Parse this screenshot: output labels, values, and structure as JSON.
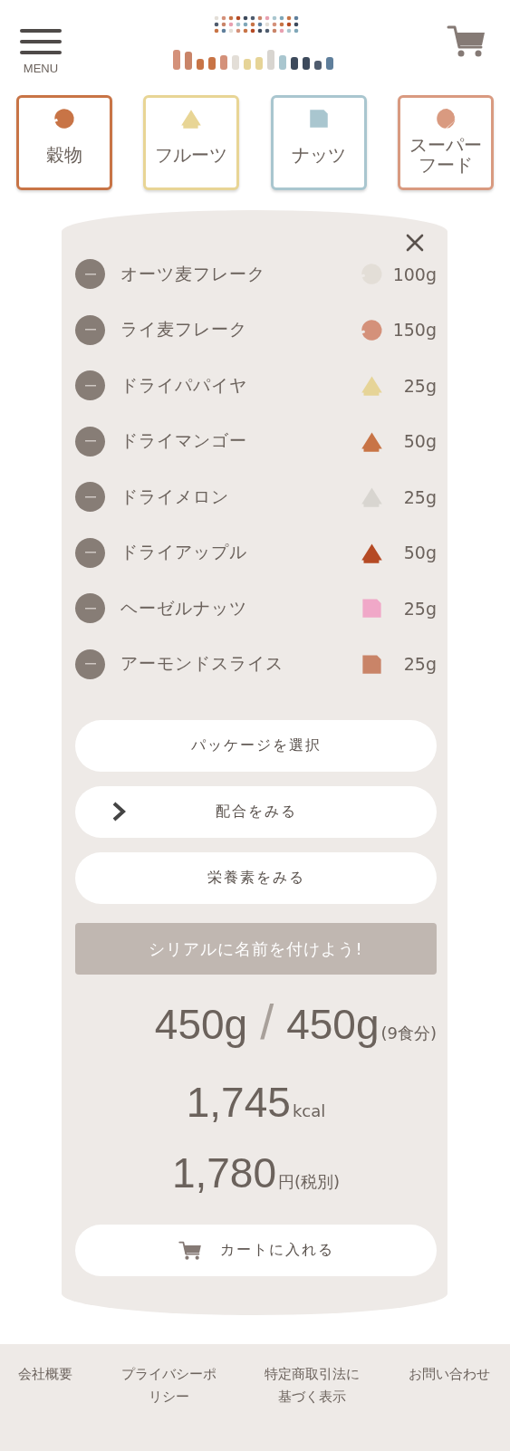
{
  "header": {
    "menu_label": "MENU"
  },
  "categories": [
    {
      "label": "穀物",
      "color": "#c87446",
      "kind": "round",
      "selected": false
    },
    {
      "label": "フルーツ",
      "color": "#e8d595",
      "kind": "triangle",
      "selected": false
    },
    {
      "label": "ナッツ",
      "color": "#a9c6cf",
      "kind": "square",
      "selected": false
    },
    {
      "label": "スーパーフード",
      "color": "#d99a80",
      "kind": "leaf",
      "selected": false
    }
  ],
  "ingredients": [
    {
      "name": "オーツ麦フレーク",
      "amount": "100g",
      "color": "#e3ded7",
      "kind": "round"
    },
    {
      "name": "ライ麦フレーク",
      "amount": "150g",
      "color": "#d4917a",
      "kind": "round"
    },
    {
      "name": "ドライパパイヤ",
      "amount": "25g",
      "color": "#e6d497",
      "kind": "triangle"
    },
    {
      "name": "ドライマンゴー",
      "amount": "50g",
      "color": "#c87446",
      "kind": "triangle"
    },
    {
      "name": "ドライメロン",
      "amount": "25g",
      "color": "#d8d5d0",
      "kind": "triangle"
    },
    {
      "name": "ドライアップル",
      "amount": "50g",
      "color": "#b54a24",
      "kind": "triangle"
    },
    {
      "name": "ヘーゼルナッツ",
      "amount": "25g",
      "color": "#f0a8c8",
      "kind": "square"
    },
    {
      "name": "アーモンドスライス",
      "amount": "25g",
      "color": "#c98468",
      "kind": "square"
    }
  ],
  "actions": [
    {
      "label": "パッケージを選択",
      "kind": "plain"
    },
    {
      "label": "配合をみる",
      "kind": "chevron"
    },
    {
      "label": "栄養素をみる",
      "kind": "plain"
    }
  ],
  "name_button": "シリアルに名前を付けよう!",
  "totals": {
    "weight": "450g",
    "separator": "/",
    "capacity": "450g",
    "servings": "(9食分)",
    "kcal": "1,745",
    "kcal_unit": "kcal",
    "price": "1,780",
    "price_unit": "円(税別)"
  },
  "cart_button": "カートに入れる",
  "footer": [
    "会社概要",
    "プライバシーポリシー",
    "特定商取引法に基づく表示",
    "お問い合わせ"
  ]
}
